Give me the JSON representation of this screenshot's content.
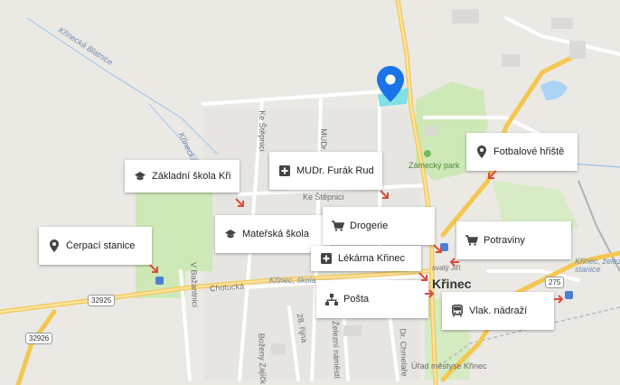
{
  "map": {
    "places": {
      "town": "Křinec",
      "park": "Zámecký park",
      "office": "Úřad městyse Křinec"
    },
    "streets": {
      "ke_stepnici_v": "Ke Štěpnici",
      "ke_stepnici_h": "Ke Štěpnici",
      "mudr": "MUDr.",
      "chotucka": "Chotucká",
      "v_bazantnici": "V Bažantnici",
      "r28_rijna": "28. října",
      "bozeny": "Boženy Zajíčk",
      "zelezni": "Železní náměstí",
      "dr_chmelare": "Dr. Chmelaře",
      "krinecka_blatnice": "Křinecká Blatnice",
      "krinecka": "Křinecká"
    },
    "transit": {
      "krinec_skola": "Křinec, škola",
      "krinec_zel_1": "Křinec, železniční",
      "krinec_zel_2": "stanice",
      "svaty": "svatý Jiří"
    },
    "shields": {
      "r32925": "32925",
      "r32926": "32926",
      "r275": "275"
    }
  },
  "pois": [
    {
      "name": "Základní škola Kři…",
      "icon": "school-icon"
    },
    {
      "name": "MUDr. Furák Rudolf",
      "icon": "medical-icon"
    },
    {
      "name": "Fotbalové hřiště",
      "icon": "place-pin-icon"
    },
    {
      "name": "Mateřská škola",
      "icon": "school-icon"
    },
    {
      "name": "Drogerie",
      "icon": "shopping-cart-icon"
    },
    {
      "name": "Čerpací stanice",
      "icon": "place-pin-icon"
    },
    {
      "name": "Potraviny",
      "icon": "shopping-cart-icon"
    },
    {
      "name": "Lékárna Křinec",
      "icon": "medical-icon"
    },
    {
      "name": "Pošta",
      "icon": "post-icon"
    },
    {
      "name": "Vlak. nádraží",
      "icon": "train-icon"
    }
  ],
  "colors": {
    "pin": "#1a73e8",
    "road_major": "#f6cf65",
    "road_minor": "#ffffff",
    "park": "#cfe8b8",
    "water": "#aad3f5",
    "arrow": "#d94c3d"
  }
}
